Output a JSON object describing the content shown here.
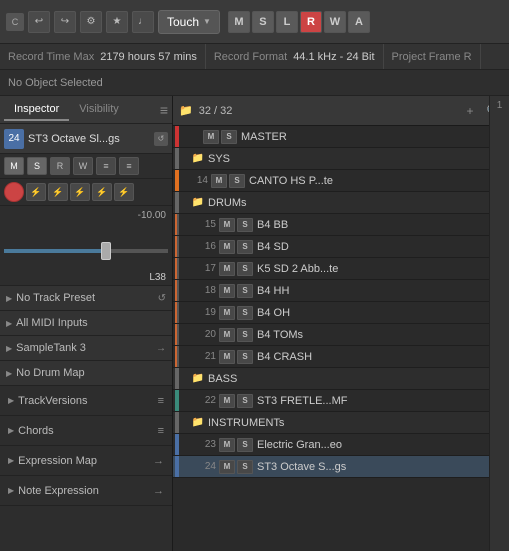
{
  "toolbar": {
    "logo": "C",
    "touch_label": "Touch",
    "transport": {
      "m": "M",
      "s": "S",
      "l": "L",
      "r": "R",
      "w": "W",
      "a": "A"
    }
  },
  "infobar": {
    "record_time_max_label": "Record Time Max",
    "record_time_max_value": "2179 hours 57 mins",
    "record_format_label": "Record Format",
    "record_format_value": "44.1 kHz - 24 Bit",
    "project_frame_label": "Project Frame R"
  },
  "no_object": "No Object Selected",
  "inspector": {
    "tabs": [
      {
        "label": "Inspector",
        "active": true
      },
      {
        "label": "Visibility",
        "active": false
      }
    ],
    "menu_icon": "≡",
    "track": {
      "num": "24",
      "name": "ST3 Octave Sl...gs",
      "reload_icon": "↺"
    },
    "controls_row1": [
      "M",
      "S",
      "R",
      "W",
      "≡",
      "≡"
    ],
    "fader": {
      "value": "-10.00",
      "pan_value": "L38"
    },
    "midi_controls": [
      "●",
      "⚡",
      "⚡",
      "⚡",
      "⚡",
      "⚡"
    ],
    "sections": [
      {
        "label": "No Track Preset",
        "icon": "↺"
      },
      {
        "label": "All MIDI Inputs",
        "icon": ""
      },
      {
        "label": "SampleTank 3",
        "icon": "→"
      }
    ],
    "drum_map": "No Drum Map",
    "track_versions": "TrackVersions",
    "chords": "Chords",
    "expression_map": "Expression Map",
    "note_expression": "Note Expression"
  },
  "track_list": {
    "header": {
      "folder_icon": "📁",
      "count": "32 / 32",
      "add_icon": "+",
      "search_icon": "🔍"
    },
    "side_num": "1",
    "tracks": [
      {
        "num": "",
        "name": "MASTER",
        "color": "col-red",
        "has_link": true,
        "indent": 0,
        "folder": false
      },
      {
        "num": "",
        "name": "SYS",
        "color": "col-gray",
        "has_link": false,
        "indent": 1,
        "folder": true
      },
      {
        "num": "14",
        "name": "CANTO HS P...te",
        "color": "col-orange",
        "has_link": true,
        "indent": 1,
        "folder": false
      },
      {
        "num": "",
        "name": "DRUMs",
        "color": "col-gray",
        "has_link": false,
        "indent": 1,
        "folder": true
      },
      {
        "num": "15",
        "name": "B4 BB",
        "color": "col-stripe",
        "has_link": true,
        "indent": 2,
        "folder": false
      },
      {
        "num": "16",
        "name": "B4 SD",
        "color": "col-stripe",
        "has_link": true,
        "indent": 2,
        "folder": false
      },
      {
        "num": "17",
        "name": "K5 SD 2 Abb...te",
        "color": "col-stripe",
        "has_link": true,
        "indent": 2,
        "folder": false
      },
      {
        "num": "18",
        "name": "B4 HH",
        "color": "col-stripe",
        "has_link": true,
        "indent": 2,
        "folder": false
      },
      {
        "num": "19",
        "name": "B4 OH",
        "color": "col-stripe",
        "has_link": true,
        "indent": 2,
        "folder": false
      },
      {
        "num": "20",
        "name": "B4 TOMs",
        "color": "col-stripe",
        "has_link": true,
        "indent": 2,
        "folder": false
      },
      {
        "num": "21",
        "name": "B4 CRASH",
        "color": "col-stripe",
        "has_link": true,
        "indent": 2,
        "folder": false
      },
      {
        "num": "",
        "name": "BASS",
        "color": "col-gray",
        "has_link": false,
        "indent": 1,
        "folder": true
      },
      {
        "num": "22",
        "name": "ST3 FRETLE...MF",
        "color": "col-teal",
        "has_link": true,
        "indent": 2,
        "folder": false
      },
      {
        "num": "",
        "name": "INSTRUMENTs",
        "color": "col-gray",
        "has_link": false,
        "indent": 1,
        "folder": true
      },
      {
        "num": "23",
        "name": "Electric Gran...eo",
        "color": "col-blue",
        "has_link": true,
        "indent": 2,
        "folder": false
      },
      {
        "num": "24",
        "name": "ST3 Octave S...gs",
        "color": "col-blue",
        "has_link": true,
        "indent": 2,
        "folder": false,
        "selected": true
      }
    ]
  }
}
